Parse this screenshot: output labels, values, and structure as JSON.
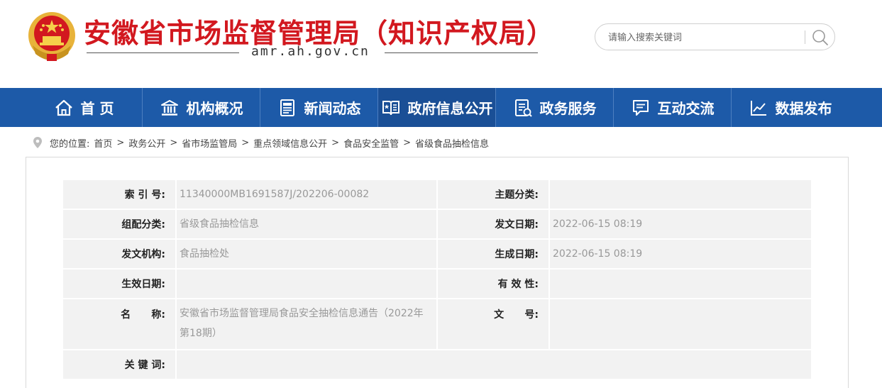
{
  "header": {
    "title": "安徽省市场监督管理局（知识产权局）",
    "domain": "amr.ah.gov.cn",
    "search_placeholder": "请输入搜索关键词"
  },
  "nav": {
    "items": [
      {
        "label": "首  页",
        "icon": "home-icon"
      },
      {
        "label": "机构概况",
        "icon": "building-icon"
      },
      {
        "label": "新闻动态",
        "icon": "newspaper-icon"
      },
      {
        "label": "政府信息公开",
        "icon": "open-book-icon"
      },
      {
        "label": "政务服务",
        "icon": "service-form-icon"
      },
      {
        "label": "互动交流",
        "icon": "chat-icon"
      },
      {
        "label": "数据发布",
        "icon": "line-chart-icon"
      }
    ],
    "active_index": 3
  },
  "breadcrumb": {
    "prefix": "您的位置:",
    "items": [
      "首页",
      "政务公开",
      "省市场监管局",
      "重点领域信息公开",
      "食品安全监管",
      "省级食品抽检信息"
    ]
  },
  "info": {
    "index_no_label": "索 引 号:",
    "index_no": "11340000MB1691587J/202206-00082",
    "topic_label": "主题分类:",
    "topic": "",
    "category_label": "组配分类:",
    "category": "省级食品抽检信息",
    "issue_date_label": "发文日期:",
    "issue_date": "2022-06-15 08:19",
    "issuer_label": "发文机构:",
    "issuer": "食品抽检处",
    "gen_date_label": "生成日期:",
    "gen_date": "2022-06-15 08:19",
    "effective_label": "生效日期:",
    "effective": "",
    "validity_label": "有 效 性:",
    "validity": "",
    "name_label": "名      称:",
    "name": "安徽省市场监督管理局食品安全抽检信息通告（2022年第18期）",
    "doc_no_label": "文      号:",
    "doc_no": "",
    "keywords_label": "关 键 词:",
    "keywords": ""
  },
  "colors": {
    "title_red": "#d2181f",
    "nav_blue": "#1d5aa8",
    "table_bg": "#f2f2f2"
  }
}
